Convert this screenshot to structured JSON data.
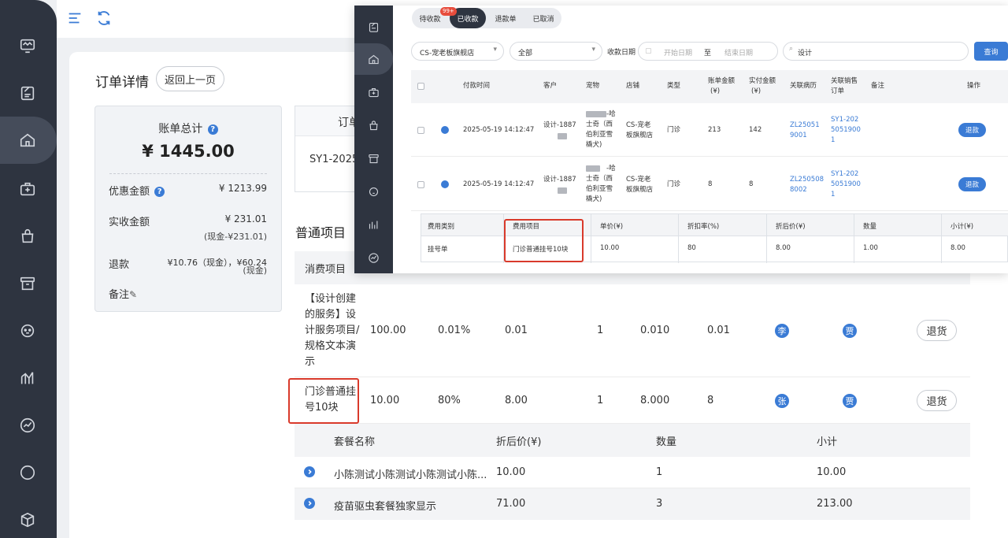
{
  "topbar": {
    "menu_icon": "menu-icon",
    "refresh_icon": "refresh-icon"
  },
  "sidebar": {
    "icons": [
      "monitor-icon",
      "notepad-icon",
      "home-icon",
      "medical-box-icon",
      "bag-icon",
      "archive-icon",
      "pet-icon",
      "chart-icon",
      "trend-icon",
      "chat-icon",
      "box-icon"
    ],
    "active_index": 2
  },
  "page": {
    "title": "订单详情",
    "back_label": "返回上一页"
  },
  "bill": {
    "title": "账单总计",
    "total": "¥ 1445.00",
    "discount_label": "优惠金额",
    "discount_value": "¥ 1213.99",
    "received_label": "实收金额",
    "received_value": "¥ 231.01",
    "received_sub": "(现金-¥231.01)",
    "refund_label": "退款",
    "refund_value_line1": "¥10.76（现金），¥60.24",
    "refund_value_line2": "(现金)",
    "remark_label": "备注"
  },
  "order": {
    "head": "订单",
    "value": "SY1-2025"
  },
  "items": {
    "section_title": "普通项目",
    "header_label": "消费项目",
    "rows": [
      {
        "name_lines": [
          "【设计创建",
          "的服务】设",
          "计服务项目/",
          "规格文本演",
          "示"
        ],
        "price": "100.00",
        "discount": "0.01%",
        "after": "0.01",
        "qty": "1",
        "subtotal": "0.010",
        "actual": "0.01",
        "staff1": "李",
        "staff2": "贾",
        "action": "退货"
      },
      {
        "name_lines": [
          "门诊普通挂",
          "号10块"
        ],
        "price": "10.00",
        "discount": "80%",
        "after": "8.00",
        "qty": "1",
        "subtotal": "8.000",
        "actual": "8",
        "staff1": "张",
        "staff2": "贾",
        "action": "退货"
      }
    ]
  },
  "packages": {
    "headers": [
      "套餐名称",
      "折后价(¥)",
      "数量",
      "小计"
    ],
    "rows": [
      {
        "name": "小陈测试小陈测试小陈测试小陈...",
        "price": "10.00",
        "qty": "1",
        "subtotal": "10.00"
      },
      {
        "name": "疫苗驱虫套餐独家显示",
        "price": "71.00",
        "qty": "3",
        "subtotal": "213.00"
      }
    ]
  },
  "overlay": {
    "tabs": [
      "待收款",
      "已收款",
      "退款单",
      "已取消"
    ],
    "active_tab": 1,
    "badge": "99+",
    "store_select": "CS-宠老板旗舰店",
    "type_select": "全部",
    "date_label": "收款日期",
    "date_start": "开始日期",
    "date_sep": "至",
    "date_end": "结束日期",
    "search_value": "设计",
    "search_btn": "查询",
    "headers": [
      "付款时间",
      "客户",
      "宠物",
      "店铺",
      "类型",
      "账单金额",
      "(¥)",
      "实付金额",
      "(¥)",
      "关联病历",
      "关联销售",
      "订单",
      "备注",
      "操作"
    ],
    "rows": [
      {
        "time": "2025-05-19 14:12:47",
        "customer": "设计-1887",
        "pet_lines": [
          "-哈",
          "士奇（西",
          "伯利亚雪",
          "橇犬)"
        ],
        "store_lines": [
          "CS-宠老",
          "板旗舰店"
        ],
        "type": "门诊",
        "amount": "213",
        "paid": "142",
        "record_lines": [
          "ZL25051",
          "9001"
        ],
        "sale_lines": [
          "SY1-202",
          "5051900",
          "1"
        ],
        "action": "退款"
      },
      {
        "time": "2025-05-19 14:12:47",
        "customer": "设计-1887",
        "pet_lines": [
          "-哈",
          "士奇（西",
          "伯利亚雪",
          "橇犬)"
        ],
        "store_lines": [
          "CS-宠老",
          "板旗舰店"
        ],
        "type": "门诊",
        "amount": "8",
        "paid": "8",
        "record_lines": [
          "ZL250508",
          "8002"
        ],
        "sale_lines": [
          "SY1-202",
          "5051900",
          "1"
        ],
        "action": "退款"
      }
    ],
    "sub_headers": [
      "费用类别",
      "费用项目",
      "单价(¥)",
      "折扣率(%)",
      "折后价(¥)",
      "数量",
      "小计(¥)"
    ],
    "sub_row": [
      "挂号单",
      "门诊普通挂号10块",
      "10.00",
      "80",
      "8.00",
      "1.00",
      "8.00"
    ]
  },
  "colors": {
    "accent": "#3a7bd5",
    "sidebar": "#2e3440",
    "highlight": "#d93a2b"
  }
}
